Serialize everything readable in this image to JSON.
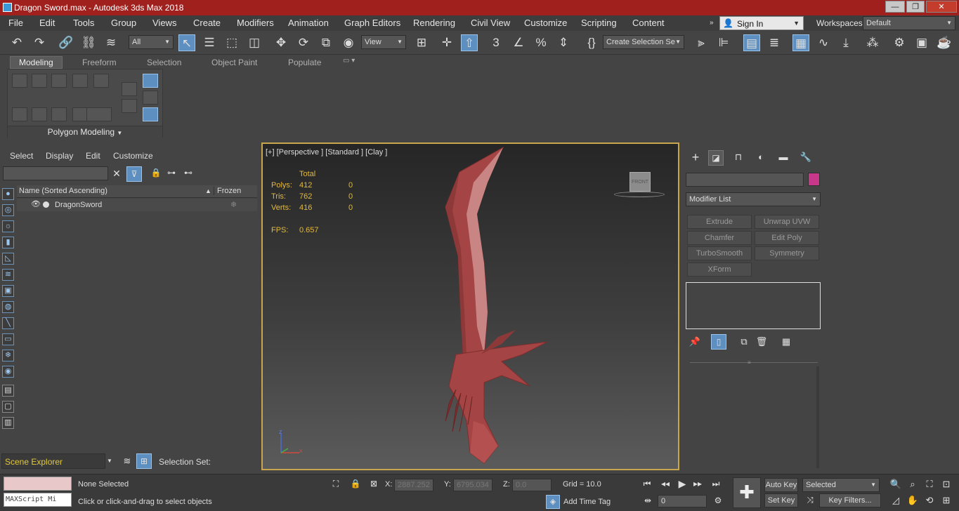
{
  "window": {
    "title": "Dragon Sword.max - Autodesk 3ds Max 2018",
    "minimize": "—",
    "maximize": "❐",
    "close": "✕"
  },
  "menu": [
    "File",
    "Edit",
    "Tools",
    "Group",
    "Views",
    "Create",
    "Modifiers",
    "Animation",
    "Graph Editors",
    "Rendering",
    "Civil View",
    "Customize",
    "Scripting",
    "Content"
  ],
  "account": {
    "sign_in": "Sign In",
    "workspaces_label": "Workspaces:",
    "workspace": "Default"
  },
  "toolbar": {
    "filter": "All",
    "ref_coord": "View",
    "selection_set": "Create Selection Se"
  },
  "ribbon": {
    "tabs": [
      "Modeling",
      "Freeform",
      "Selection",
      "Object Paint",
      "Populate"
    ],
    "panel_label": "Polygon Modeling"
  },
  "scene_explorer": {
    "menu": [
      "Select",
      "Display",
      "Edit",
      "Customize"
    ],
    "search_placeholder": "",
    "col_name": "Name (Sorted Ascending)",
    "col_frozen": "Frozen",
    "rows": [
      {
        "name": "DragonSword"
      }
    ],
    "footer_name": "Scene Explorer",
    "selection_set_label": "Selection Set:"
  },
  "viewport": {
    "label": "[+] [Perspective ] [Standard ] [Clay ]",
    "stats_header": "Total",
    "stats": [
      {
        "label": "Polys:",
        "total": "412",
        "sel": "0"
      },
      {
        "label": "Tris:",
        "total": "762",
        "sel": "0"
      },
      {
        "label": "Verts:",
        "total": "416",
        "sel": "0"
      }
    ],
    "fps_label": "FPS:",
    "fps": "0.657",
    "viewcube": "FRONT",
    "axis_z": "z",
    "axis_x": "x"
  },
  "command_panel": {
    "name_value": "",
    "object_color": "#c8378a",
    "modifier_list": "Modifier List",
    "modifier_buttons": [
      "Extrude",
      "Unwrap UVW",
      "Chamfer",
      "Edit Poly",
      "TurboSmooth",
      "Symmetry",
      "XForm"
    ]
  },
  "status": {
    "maxscript": "MAXScript Mi",
    "none_selected": "None Selected",
    "prompt": "Click or click-and-drag to select objects",
    "x_label": "X:",
    "x_value": "2887.252",
    "y_label": "Y:",
    "y_value": "6795.034",
    "z_label": "Z:",
    "z_value": "0.0",
    "grid": "Grid = 10.0",
    "add_time_tag": "Add Time Tag",
    "auto_key": "Auto Key",
    "set_key": "Set Key",
    "key_mode": "Selected",
    "key_filters": "Key Filters...",
    "frame": "0"
  },
  "colors": {
    "title_bar": "#a0201e",
    "viewport_border": "#c8a64b",
    "stats_text": "#e3b93b",
    "sword": "#a54444"
  }
}
